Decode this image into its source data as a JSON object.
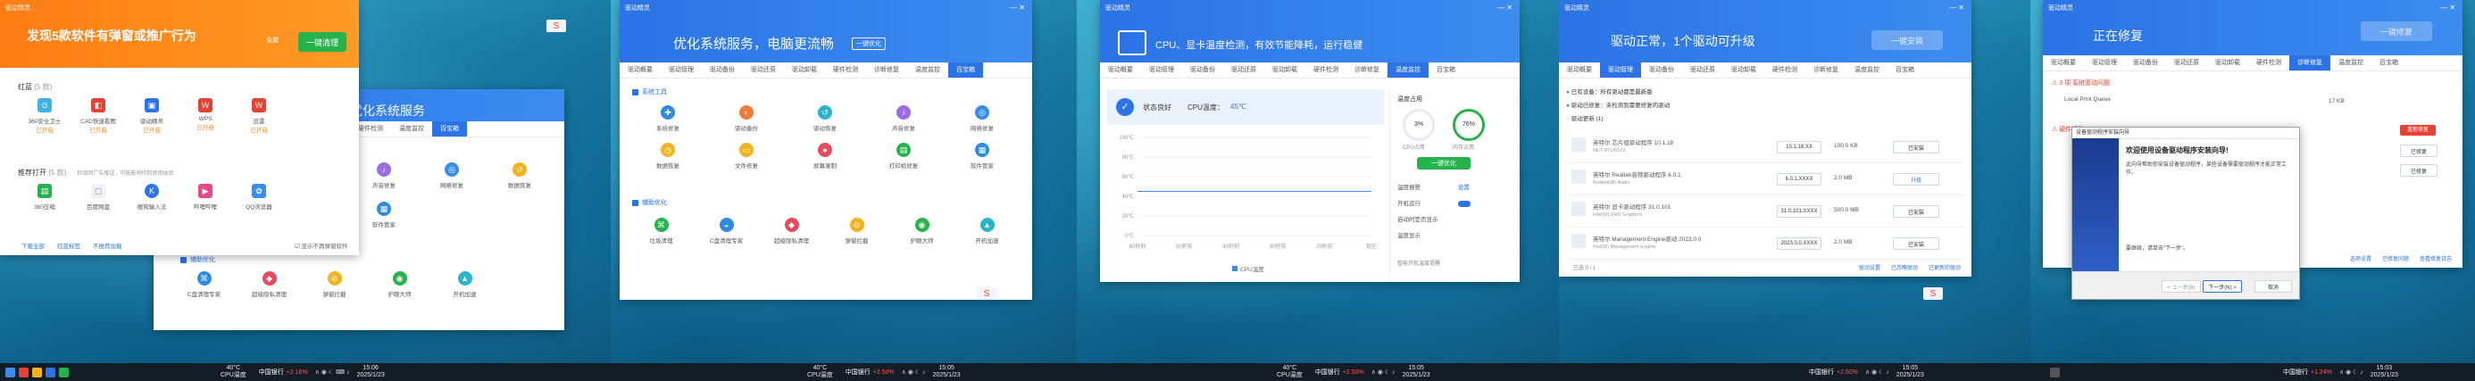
{
  "app": {
    "logo": "驱动精灵"
  },
  "panel1": {
    "banner_title": "发现5款软件有弹窗或推广行为",
    "banner_tag": "",
    "free_label": "免费",
    "clean_button": "一键清理",
    "sec1_title": "红蓝",
    "sec1_count": "(5 款)",
    "apps1": [
      "360安全卫士",
      "CAD快速看图",
      "驱动精灵",
      "WPS",
      "迅雷"
    ],
    "apps1_state": [
      "已开启",
      "已开启",
      "已开启",
      "已开启",
      "已开启"
    ],
    "sec2_title": "推荐打开",
    "sec2_count": "(5 款)",
    "sec2_tip": "检测到广告推送，可能影响你的使用体验",
    "apps2": [
      "360压缩",
      "百度网盘",
      "搜狗输入法",
      "哔哩哔哩",
      "QQ浏览器"
    ],
    "links": [
      "下载全部",
      "红蓝标签",
      "不推荐加载"
    ],
    "checkbox_label": "显示不再弹窗软件",
    "back_title": "优化系统服务",
    "back_tabs": [
      "硬件检测",
      "温度监控",
      "百宝箱"
    ],
    "back_tiles": [
      "声音修复",
      "网络修复",
      "数据恢复",
      "C盘清理专家",
      "超级隐私清理",
      "弹窗拦截",
      "护眼大师",
      "开机加速",
      "软件管家"
    ],
    "back_sec": "辅助优化",
    "side_label": "驱动管理",
    "taskbar_cpu_temp": "40°C",
    "taskbar_cpu_label": "CPU温度",
    "bank": "中国银行",
    "bank_change": "+2.16%",
    "time": "15:06",
    "date": "2025/1/23"
  },
  "panel2": {
    "title": "优化系统服务，电脑更流畅",
    "title_tag": "一键优化",
    "tabs": [
      "驱动概要",
      "驱动管理",
      "驱动备份",
      "驱动还原",
      "驱动卸载",
      "硬件检测",
      "诊断修复",
      "温度监控",
      "百宝箱"
    ],
    "sec1": "系统工具",
    "tools": [
      "系统修复",
      "驱动备份",
      "驱动恢复",
      "声音修复",
      "网络修复",
      "数据恢复",
      "文件修复",
      "屏幕录制",
      "打印机修复",
      "软件管家"
    ],
    "sec2": "辅助优化",
    "assist": [
      "垃圾清理",
      "C盘清理专家",
      "超级隐私清理",
      "弹窗拦截",
      "护眼大师",
      "开机加速"
    ],
    "taskbar_cpu_temp": "40°C",
    "taskbar_cpu_label": "CPU温度",
    "bank": "中国银行",
    "bank_change": "+2.50%",
    "time": "15:05",
    "date": "2025/1/23"
  },
  "panel3": {
    "title": "CPU、显卡温度检测，有效节能降耗，运行稳健",
    "tabs": [
      "驱动概要",
      "驱动管理",
      "驱动备份",
      "驱动还原",
      "驱动卸载",
      "硬件检测",
      "诊断修复",
      "温度监控",
      "百宝箱"
    ],
    "status": "状态良好",
    "cpu_temp_label": "CPU温度：",
    "cpu_temp": "45℃",
    "y_ticks": [
      "100℃",
      "80℃",
      "60℃",
      "40℃",
      "20℃",
      "0℃"
    ],
    "x_ticks": [
      "60秒前",
      "50秒前",
      "40秒前",
      "30秒前",
      "20秒前",
      "现在"
    ],
    "legend": "CPU温度",
    "side_title": "温度占用",
    "cpu_usage": "3%",
    "cpu_usage_label": "CPU占用",
    "mem_usage": "76%",
    "mem_usage_label": "内存占用",
    "opt_button": "一键优化",
    "links": [
      "温度报警",
      "开机运行",
      "启动时是否显示",
      "温度显示"
    ],
    "alarm_link": "设置",
    "footer": "智能开机温度提醒",
    "chart_data": {
      "type": "line",
      "x": [
        60,
        50,
        40,
        30,
        20,
        0
      ],
      "series": [
        {
          "name": "CPU温度",
          "values": [
            45,
            45,
            45,
            45,
            45,
            45
          ]
        }
      ],
      "ylim": [
        0,
        100
      ]
    },
    "taskbar_cpu_temp": "40°C",
    "taskbar_cpu_label": "CPU温度",
    "bank": "中国银行",
    "bank_change": "+2.50%",
    "time": "15:05",
    "date": "2025/1/23"
  },
  "panel4": {
    "title": "驱动正常，1个驱动可升级",
    "title_btn": "一键安装",
    "tabs": [
      "驱动概要",
      "驱动管理",
      "驱动备份",
      "驱动还原",
      "驱动卸载",
      "硬件检测",
      "诊断修复",
      "温度监控",
      "百宝箱"
    ],
    "s_ok": "已有设备：所有驱动都是最新版",
    "s_rec": "驱动已修复：未检测到需要修复的驱动",
    "s_up": "驱动更新",
    "s_up_count": "(1)",
    "drivers": [
      {
        "name": "英特尔 芯片组驱动程序 10.1.18",
        "sub": "NET RTL8XXX",
        "ver": "10.1.18.XX",
        "size": "100.0 KB",
        "action": "已安装"
      },
      {
        "name": "英特尔 Realtek音频驱动程序 6.0.1",
        "sub": "Realtek(R) Audio",
        "ver": "6.0.1.XXXX",
        "size": "2.0 MB",
        "action": "升级"
      },
      {
        "name": "英特尔 显卡驱动程序 31.0.101",
        "sub": "Intel(R) UHD Graphics",
        "ver": "31.0.101.XXXX",
        "size": "500.0 MB",
        "action": "已安装"
      },
      {
        "name": "英特尔 Management Engine驱动 2023.0.0",
        "sub": "Intel(R) Management Engine",
        "ver": "2023.0.0.XXXX",
        "size": "2.0 MB",
        "action": "已安装"
      }
    ],
    "footer_left": "已选 0 / 1",
    "footer_links": [
      "驱动设置",
      "已忽略驱动",
      "已更新的驱动"
    ],
    "taskbar_cpu_temp": "40°C",
    "taskbar_cpu_label": "CPU温度",
    "bank": "中国银行",
    "bank_change": "+2.50%",
    "time": "15:05",
    "date": "2025/1/23"
  },
  "panel5": {
    "title": "正在修复",
    "title_btn": "一键修复",
    "tabs": [
      "驱动概要",
      "驱动管理",
      "驱动备份",
      "驱动还原",
      "驱动卸载",
      "硬件检测",
      "诊断修复",
      "温度监控",
      "百宝箱"
    ],
    "issue1": "3 项 系统驱动问题",
    "issue1_sub": "Local Print Queue",
    "issue2": "硬件驱动",
    "size": "17 KB",
    "red_btn": "重新修复",
    "btn2": "已修复",
    "btn3": "已修复",
    "dialog_title": "设备驱动程序安装向导",
    "dialog_heading": "欢迎使用设备驱动程序安装向导!",
    "dialog_body": "此向导帮助你安装设备驱动程序，某些设备需要驱动程序才能正常工作。",
    "dialog_next": "要继续，请单击“下一步”。",
    "btn_prev": "< 上一步(B)",
    "btn_next": "下一步(N) >",
    "btn_cancel": "取消",
    "footer_links": [
      "选项设置",
      "已修复问题",
      "查看修复日志"
    ],
    "bank": "中国银行",
    "bank_change": "+1.24%",
    "time": "15:03",
    "date": "2025/1/23"
  }
}
